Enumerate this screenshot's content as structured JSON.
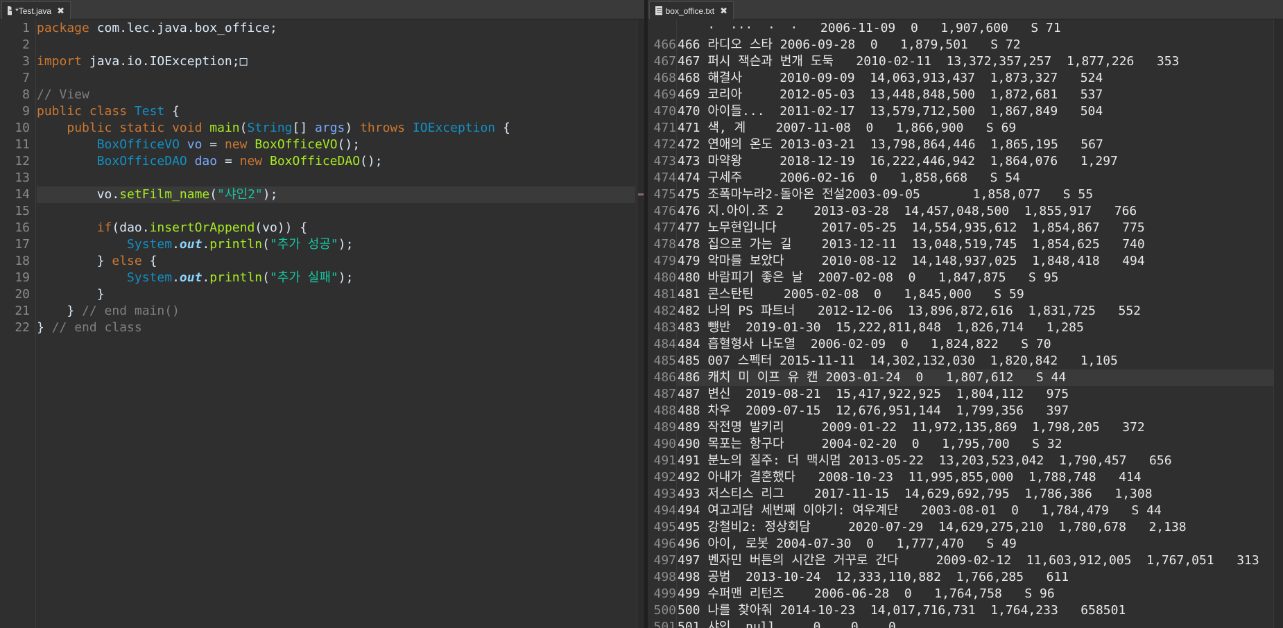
{
  "left_editor": {
    "tab_title": "*Test.java",
    "tab_file_icon": "java-file-icon",
    "close_icon": "close-icon",
    "current_line": 14,
    "lines": [
      {
        "num": "1",
        "segs": [
          [
            "kw",
            "package"
          ],
          [
            "plain",
            " com.lec.java.box_office;"
          ]
        ]
      },
      {
        "num": "2",
        "segs": []
      },
      {
        "num": "3",
        "segs": [
          [
            "kw",
            "import"
          ],
          [
            "plain",
            " java.io.IOException;"
          ],
          [
            "plain",
            "□"
          ]
        ]
      },
      {
        "num": "7",
        "segs": []
      },
      {
        "num": "8",
        "segs": [
          [
            "cmt",
            "// View"
          ]
        ]
      },
      {
        "num": "9",
        "segs": [
          [
            "kw",
            "public class "
          ],
          [
            "typ",
            "Test"
          ],
          [
            "plain",
            " {"
          ]
        ]
      },
      {
        "num": "10",
        "segs": [
          [
            "plain",
            "    "
          ],
          [
            "kw",
            "public static void "
          ],
          [
            "fn",
            "main"
          ],
          [
            "plain",
            "("
          ],
          [
            "typ",
            "String"
          ],
          [
            "plain",
            "[] "
          ],
          [
            "var",
            "args"
          ],
          [
            "plain",
            ") "
          ],
          [
            "kw",
            "throws "
          ],
          [
            "typ",
            "IOException"
          ],
          [
            "plain",
            " {"
          ]
        ]
      },
      {
        "num": "11",
        "segs": [
          [
            "plain",
            "        "
          ],
          [
            "typ",
            "BoxOfficeVO"
          ],
          [
            "plain",
            " "
          ],
          [
            "var",
            "vo"
          ],
          [
            "plain",
            " = "
          ],
          [
            "kw",
            "new "
          ],
          [
            "fn",
            "BoxOfficeVO"
          ],
          [
            "plain",
            "();"
          ]
        ]
      },
      {
        "num": "12",
        "segs": [
          [
            "plain",
            "        "
          ],
          [
            "typ",
            "BoxOfficeDAO"
          ],
          [
            "plain",
            " "
          ],
          [
            "var",
            "dao"
          ],
          [
            "plain",
            " = "
          ],
          [
            "kw",
            "new "
          ],
          [
            "fn",
            "BoxOfficeDAO"
          ],
          [
            "plain",
            "();"
          ]
        ]
      },
      {
        "num": "13",
        "segs": []
      },
      {
        "num": "14",
        "segs": [
          [
            "plain",
            "        vo."
          ],
          [
            "fn",
            "setFilm_name"
          ],
          [
            "plain",
            "("
          ],
          [
            "str",
            "\"샤인2\""
          ],
          [
            "plain",
            ");"
          ]
        ]
      },
      {
        "num": "15",
        "segs": []
      },
      {
        "num": "16",
        "segs": [
          [
            "plain",
            "        "
          ],
          [
            "kw",
            "if"
          ],
          [
            "plain",
            "(dao."
          ],
          [
            "fn",
            "insertOrAppend"
          ],
          [
            "plain",
            "(vo)) {"
          ]
        ]
      },
      {
        "num": "17",
        "segs": [
          [
            "plain",
            "            "
          ],
          [
            "typ",
            "System"
          ],
          [
            "plain",
            "."
          ],
          [
            "fld",
            "out"
          ],
          [
            "plain",
            "."
          ],
          [
            "fn",
            "println"
          ],
          [
            "plain",
            "("
          ],
          [
            "str",
            "\"추가 성공\""
          ],
          [
            "plain",
            ");"
          ]
        ]
      },
      {
        "num": "18",
        "segs": [
          [
            "plain",
            "        } "
          ],
          [
            "kw",
            "else"
          ],
          [
            "plain",
            " {"
          ]
        ]
      },
      {
        "num": "19",
        "segs": [
          [
            "plain",
            "            "
          ],
          [
            "typ",
            "System"
          ],
          [
            "plain",
            "."
          ],
          [
            "fld",
            "out"
          ],
          [
            "plain",
            "."
          ],
          [
            "fn",
            "println"
          ],
          [
            "plain",
            "("
          ],
          [
            "str",
            "\"추가 실패\""
          ],
          [
            "plain",
            ");"
          ]
        ]
      },
      {
        "num": "20",
        "segs": [
          [
            "plain",
            "        }"
          ]
        ]
      },
      {
        "num": "21",
        "segs": [
          [
            "plain",
            "    } "
          ],
          [
            "cmt",
            "// end main()"
          ]
        ]
      },
      {
        "num": "22",
        "segs": [
          [
            "plain",
            "} "
          ],
          [
            "cmt",
            "// end class"
          ]
        ]
      }
    ],
    "colors": {
      "keyword": "#cc7832",
      "type": "#1290c3",
      "method": "#a7ec21",
      "string": "#17c6a3",
      "comment": "#7f7f7f"
    }
  },
  "right_editor": {
    "tab_title": "box_office.txt",
    "tab_file_icon": "text-file-icon",
    "close_icon": "close-icon",
    "current_line": "486",
    "lines": [
      {
        "num": "",
        "text": "    ·  ···  ·  ·   2006-11-09  0   1,907,600   S 71"
      },
      {
        "num": "466",
        "text": "466 라디오 스타 2006-09-28  0   1,879,501   S 72"
      },
      {
        "num": "467",
        "text": "467 퍼시 잭슨과 번개 도둑   2010-02-11  13,372,357,257  1,877,226   353"
      },
      {
        "num": "468",
        "text": "468 해결사     2010-09-09  14,063,913,437  1,873,327   524"
      },
      {
        "num": "469",
        "text": "469 코리아     2012-05-03  13,448,848,500  1,872,681   537"
      },
      {
        "num": "470",
        "text": "470 아이들...  2011-02-17  13,579,712,500  1,867,849   504"
      },
      {
        "num": "471",
        "text": "471 색, 계    2007-11-08  0   1,866,900   S 69"
      },
      {
        "num": "472",
        "text": "472 연애의 온도 2013-03-21  13,798,864,446  1,865,195   567"
      },
      {
        "num": "473",
        "text": "473 마약왕     2018-12-19  16,222,446,942  1,864,076   1,297"
      },
      {
        "num": "474",
        "text": "474 구세주     2006-02-16  0   1,858,668   S 54"
      },
      {
        "num": "475",
        "text": "475 조폭마누라2-돌아온 전설2003-09-05       1,858,077   S 55"
      },
      {
        "num": "476",
        "text": "476 지.아이.조 2    2013-03-28  14,457,048,500  1,855,917   766"
      },
      {
        "num": "477",
        "text": "477 노무현입니다      2017-05-25  14,554,935,612  1,854,867   775"
      },
      {
        "num": "478",
        "text": "478 집으로 가는 길    2013-12-11  13,048,519,745  1,854,625   740"
      },
      {
        "num": "479",
        "text": "479 악마를 보았다     2010-08-12  14,148,937,025  1,848,418   494"
      },
      {
        "num": "480",
        "text": "480 바람피기 좋은 날  2007-02-08  0   1,847,875   S 95"
      },
      {
        "num": "481",
        "text": "481 콘스탄틴    2005-02-08  0   1,845,000   S 59"
      },
      {
        "num": "482",
        "text": "482 나의 PS 파트너   2012-12-06  13,896,872,616  1,831,725   552"
      },
      {
        "num": "483",
        "text": "483 뺑반  2019-01-30  15,222,811,848  1,826,714   1,285"
      },
      {
        "num": "484",
        "text": "484 흡혈형사 나도열  2006-02-09  0   1,824,822   S 70"
      },
      {
        "num": "485",
        "text": "485 007 스펙터 2015-11-11  14,302,132,030  1,820,842   1,105"
      },
      {
        "num": "486",
        "text": "486 캐치 미 이프 유 캔 2003-01-24  0   1,807,612   S 44"
      },
      {
        "num": "487",
        "text": "487 변신  2019-08-21  15,417,922,925  1,804,112   975"
      },
      {
        "num": "488",
        "text": "488 차우  2009-07-15  12,676,951,144  1,799,356   397"
      },
      {
        "num": "489",
        "text": "489 작전명 발키리     2009-01-22  11,972,135,869  1,798,205   372"
      },
      {
        "num": "490",
        "text": "490 목포는 항구다     2004-02-20  0   1,795,700   S 32"
      },
      {
        "num": "491",
        "text": "491 분노의 질주: 더 맥시멈 2013-05-22  13,203,523,042  1,790,457   656"
      },
      {
        "num": "492",
        "text": "492 아내가 결혼했다   2008-10-23  11,995,855,000  1,788,748   414"
      },
      {
        "num": "493",
        "text": "493 저스티스 리그    2017-11-15  14,629,692,795  1,786,386   1,308"
      },
      {
        "num": "494",
        "text": "494 여고괴담 세번째 이야기: 여우계단   2003-08-01  0   1,784,479   S 44"
      },
      {
        "num": "495",
        "text": "495 강철비2: 정상회담     2020-07-29  14,629,275,210  1,780,678   2,138"
      },
      {
        "num": "496",
        "text": "496 아이, 로봇 2004-07-30  0   1,777,470   S 49"
      },
      {
        "num": "497",
        "text": "497 벤자민 버튼의 시간은 거꾸로 간다     2009-02-12  11,603,912,005  1,767,051   313"
      },
      {
        "num": "498",
        "text": "498 공범  2013-10-24  12,333,110,882  1,766,285   611"
      },
      {
        "num": "499",
        "text": "499 수퍼맨 리턴즈    2006-06-28  0   1,764,758   S 96"
      },
      {
        "num": "500",
        "text": "500 나를 찾아줘 2014-10-23  14,017,716,731  1,764,233   658501"
      },
      {
        "num": "501",
        "text": "501 샤인  null     0    0    0"
      }
    ]
  }
}
